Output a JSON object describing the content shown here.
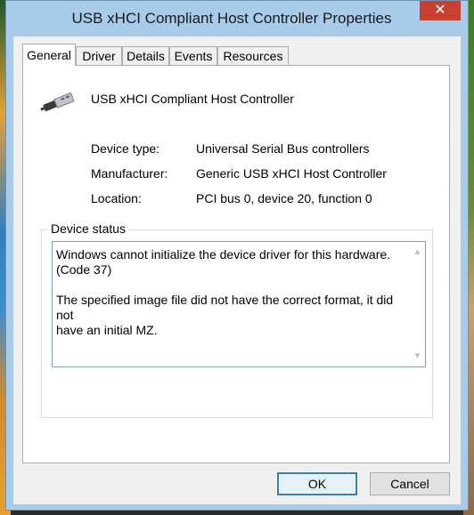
{
  "window": {
    "title": "USB xHCI Compliant Host Controller Properties",
    "close_glyph": "✕"
  },
  "tabs": [
    {
      "label": "General"
    },
    {
      "label": "Driver"
    },
    {
      "label": "Details"
    },
    {
      "label": "Events"
    },
    {
      "label": "Resources"
    }
  ],
  "device": {
    "name": "USB xHCI Compliant Host Controller",
    "properties": [
      {
        "label": "Device type:",
        "value": "Universal Serial Bus controllers"
      },
      {
        "label": "Manufacturer:",
        "value": "Generic USB xHCI Host Controller"
      },
      {
        "label": "Location:",
        "value": "PCI bus 0, device 20, function 0"
      }
    ]
  },
  "status": {
    "group_label": "Device status",
    "text": "Windows cannot initialize the device driver for this hardware.\n(Code 37)\n\nThe specified image file did not have the correct format, it did not\nhave an initial MZ."
  },
  "buttons": {
    "ok": "OK",
    "cancel": "Cancel"
  }
}
